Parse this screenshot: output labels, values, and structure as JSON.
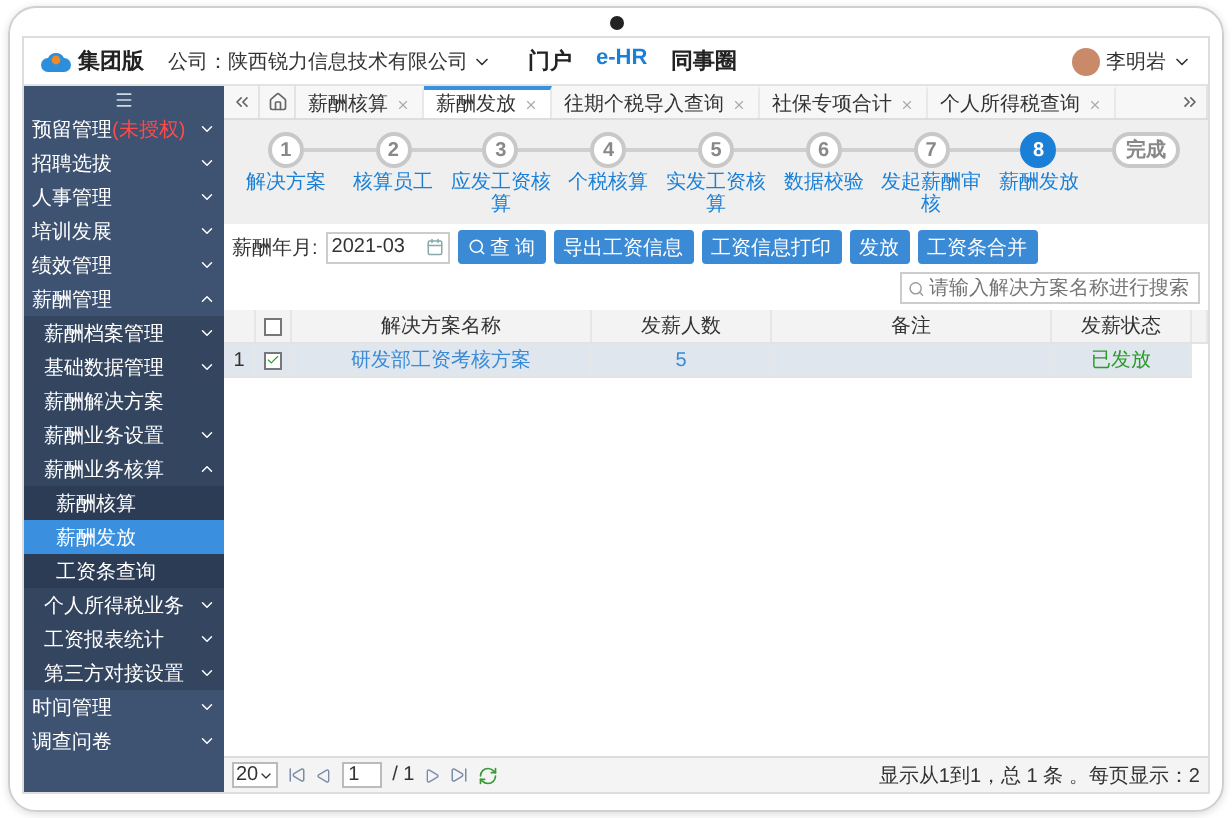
{
  "header": {
    "logo": "集团版",
    "company": "公司：陕西锐力信息技术有限公司",
    "nav": [
      {
        "label": "门户",
        "selected": false
      },
      {
        "label": "e-HR",
        "selected": true
      },
      {
        "label": "同事圈",
        "selected": false
      }
    ],
    "user": "李明岩"
  },
  "sidebar": {
    "items": [
      {
        "label": "预留管理",
        "note": "(未授权)",
        "selected": false,
        "expanded": false
      },
      {
        "label": "招聘选拔",
        "selected": false,
        "expanded": false
      },
      {
        "label": "人事管理",
        "selected": false,
        "expanded": false
      },
      {
        "label": "培训发展",
        "selected": false,
        "expanded": false
      },
      {
        "label": "绩效管理",
        "selected": false,
        "expanded": false
      },
      {
        "label": "薪酬管理",
        "selected": false,
        "expanded": true,
        "children": [
          {
            "label": "薪酬档案管理",
            "selected": false,
            "expanded": false
          },
          {
            "label": "基础数据管理",
            "selected": false,
            "expanded": false
          },
          {
            "label": "薪酬解决方案",
            "selected": false
          },
          {
            "label": "薪酬业务设置",
            "selected": false,
            "expanded": false
          },
          {
            "label": "薪酬业务核算",
            "selected": false,
            "expanded": true,
            "children": [
              {
                "label": "薪酬核算",
                "selected": false
              },
              {
                "label": "薪酬发放",
                "selected": true
              },
              {
                "label": "工资条查询",
                "selected": false
              }
            ]
          },
          {
            "label": "个人所得税业务",
            "selected": false,
            "expanded": false
          },
          {
            "label": "工资报表统计",
            "selected": false,
            "expanded": false
          },
          {
            "label": "第三方对接设置",
            "selected": false,
            "expanded": false
          }
        ]
      },
      {
        "label": "时间管理",
        "selected": false,
        "expanded": false
      },
      {
        "label": "调查问卷",
        "selected": false,
        "expanded": false
      }
    ]
  },
  "tabs": [
    {
      "label": "薪酬核算",
      "selected": false
    },
    {
      "label": "薪酬发放",
      "selected": true
    },
    {
      "label": "往期个税导入查询",
      "selected": false
    },
    {
      "label": "社保专项合计",
      "selected": false
    },
    {
      "label": "个人所得税查询",
      "selected": false
    }
  ],
  "steps": [
    {
      "kind": "step",
      "number": "1",
      "label": "解决方案",
      "current": false
    },
    {
      "kind": "step",
      "number": "2",
      "label": "核算员工",
      "current": false
    },
    {
      "kind": "step",
      "number": "3",
      "label": "应发工资核算",
      "current": false
    },
    {
      "kind": "step",
      "number": "4",
      "label": "个税核算",
      "current": false
    },
    {
      "kind": "step",
      "number": "5",
      "label": "实发工资核算",
      "current": false
    },
    {
      "kind": "step",
      "number": "6",
      "label": "数据校验",
      "current": false
    },
    {
      "kind": "step",
      "number": "7",
      "label": "发起薪酬审核",
      "current": false
    },
    {
      "kind": "step",
      "number": "8",
      "label": "薪酬发放",
      "current": true
    },
    {
      "kind": "end",
      "number": "完成",
      "current": false
    }
  ],
  "toolbar": {
    "month_label": "薪酬年月:",
    "month_value": "2021-03",
    "buttons": [
      {
        "label": "查 询",
        "kind": "search"
      },
      {
        "label": "导出工资信息",
        "kind": "plain"
      },
      {
        "label": "工资信息打印",
        "kind": "plain"
      },
      {
        "label": "发放",
        "kind": "plain"
      },
      {
        "label": "工资条合并",
        "kind": "plain"
      }
    ],
    "search": {
      "placeholder": "请输入解决方案名称进行搜索"
    }
  },
  "table": {
    "all_checked": false,
    "columns": [
      "解决方案名称",
      "发薪人数",
      "备注",
      "发薪状态"
    ],
    "rows": [
      {
        "index": "1",
        "checked": true,
        "selected": true,
        "name": "研发部工资考核方案",
        "count": "5",
        "status": "已发放"
      }
    ]
  },
  "footer": {
    "page_size": "20",
    "page": "1",
    "total_pages": "/ 1",
    "info": "显示从1到1，总 1 条 。每页显示：2"
  }
}
